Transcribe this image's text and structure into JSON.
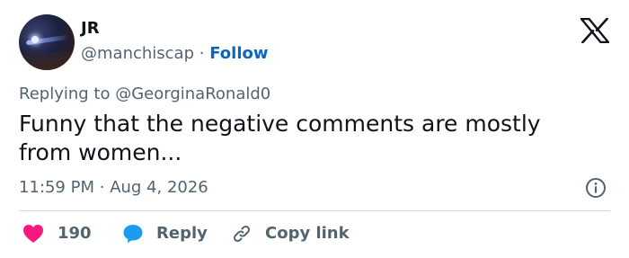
{
  "author": {
    "name": "JR",
    "handle": "@manchiscap",
    "separator": "·",
    "follow_label": "Follow"
  },
  "reply_context": {
    "prefix": "Replying to",
    "mention": "@GeorginaRonald0"
  },
  "tweet": {
    "text": "Funny that the negative comments are mostly from women...",
    "time": "11:59 PM",
    "separator": "·",
    "date": "Aug 4, 2026"
  },
  "actions": {
    "like_count": "190",
    "reply_label": "Reply",
    "copy_link_label": "Copy link"
  },
  "icons": {
    "brand": "x-logo-icon",
    "info": "info-icon",
    "like": "heart-icon",
    "reply": "speech-bubble-icon",
    "copy": "link-icon"
  },
  "colors": {
    "text_primary": "#0f1419",
    "text_secondary": "#536471",
    "follow_link": "#0a66c2",
    "heart": "#f91880",
    "reply_bubble": "#1d9bf0",
    "divider": "#cfd9de"
  }
}
